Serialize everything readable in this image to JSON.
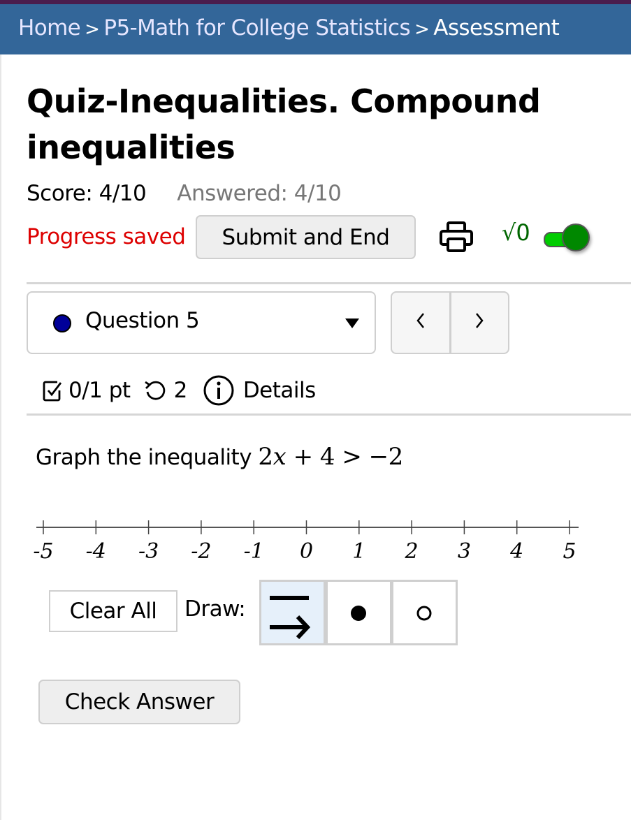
{
  "breadcrumb": {
    "items": [
      "Home",
      "P5-Math for College Statistics"
    ],
    "current": "Assessment",
    "separator": ">"
  },
  "quiz": {
    "title": "Quiz-Inequalities. Compound inequalities",
    "score_label": "Score: 4/10",
    "answered_label": "Answered: 4/10",
    "progress_status": "Progress saved",
    "submit_label": "Submit and End",
    "math_toggle_label": "√0",
    "math_toggle_on": true
  },
  "colors": {
    "header_bg": "#336699",
    "progress_saved": "#dd0000",
    "toggle_on": "#00cc00",
    "question_dot": "#000099",
    "active_tool_bg": "#e6f0fa"
  },
  "question_nav": {
    "selected": "Question 5",
    "prev_label": "<",
    "next_label": ">"
  },
  "question_meta": {
    "points": "0/1 pt",
    "retries": "2",
    "details_label": "Details",
    "icons": [
      "checkbox-icon",
      "retry-icon",
      "info-icon"
    ]
  },
  "question": {
    "prompt_text": "Graph the inequality",
    "math": {
      "lhs_coef": "2",
      "variable": "x",
      "op": "+",
      "const": "4",
      "relation": ">",
      "rhs": "−2"
    }
  },
  "number_line": {
    "min": -5,
    "max": 5,
    "ticks": [
      "-5",
      "-4",
      "-3",
      "-2",
      "-1",
      "0",
      "1",
      "2",
      "3",
      "4",
      "5"
    ]
  },
  "draw_tools": {
    "clear_label": "Clear All",
    "draw_label": "Draw:",
    "tools": [
      {
        "name": "ray",
        "icon": "ray-arrow-icon",
        "active": true
      },
      {
        "name": "closed-dot",
        "icon": "closed-dot-icon",
        "active": false
      },
      {
        "name": "open-dot",
        "icon": "open-dot-icon",
        "active": false
      }
    ]
  },
  "actions": {
    "check_answer_label": "Check Answer"
  }
}
